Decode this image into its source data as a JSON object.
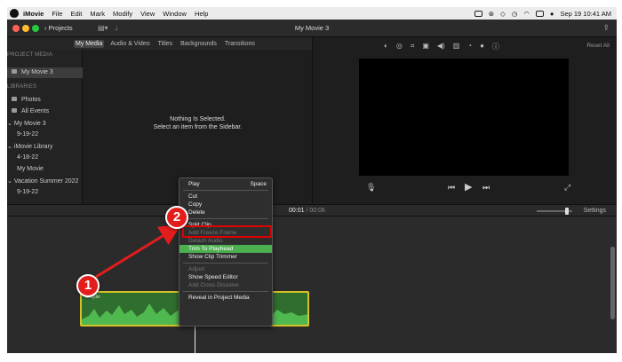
{
  "menubar": {
    "items": [
      "iMovie",
      "File",
      "Edit",
      "Mark",
      "Modify",
      "View",
      "Window",
      "Help"
    ],
    "clock": "Sep 19  10:41 AM"
  },
  "window": {
    "title": "My Movie 3",
    "projects_label": "Projects"
  },
  "tabs": [
    "My Media",
    "Audio & Video",
    "Titles",
    "Backgrounds",
    "Transitions"
  ],
  "sidebar": {
    "project_media_header": "PROJECT MEDIA",
    "project_item": "My Movie 3",
    "libraries_header": "LIBRARIES",
    "photos": "Photos",
    "all_events": "All Events",
    "library1": "My Movie 3",
    "library1_event": "9-19-22",
    "library2": "iMovie Library",
    "library2_event1": "4-18-22",
    "library2_event2": "My Movie",
    "library3": "Vacation Summer 2022",
    "library3_event": "9-19-22"
  },
  "browser": {
    "empty_line1": "Nothing Is Selected.",
    "empty_line2": "Select an item from the Sidebar."
  },
  "viewer": {
    "reset_all": "Reset All"
  },
  "timebar": {
    "current": "00:01",
    "separator": "/",
    "duration": "00:06",
    "settings": "Settings"
  },
  "clip": {
    "title": "ample"
  },
  "context_menu": {
    "play": "Play",
    "play_shortcut": "Space",
    "cut": "Cut",
    "copy": "Copy",
    "delete": "Delete",
    "split_clip": "Split Clip",
    "add_freeze_frame": "Add Freeze Frame",
    "detach_audio": "Detach Audio",
    "trim_to_playhead": "Trim To Playhead",
    "show_clip_trimmer": "Show Clip Trimmer",
    "adjust": "Adjust",
    "show_speed_editor": "Show Speed Editor",
    "add_cross_dissolve": "Add Cross Dissolve",
    "reveal_in_project_media": "Reveal in Project Media"
  },
  "annotations": {
    "step1": "1",
    "step2": "2",
    "color": "#e31c1c"
  }
}
